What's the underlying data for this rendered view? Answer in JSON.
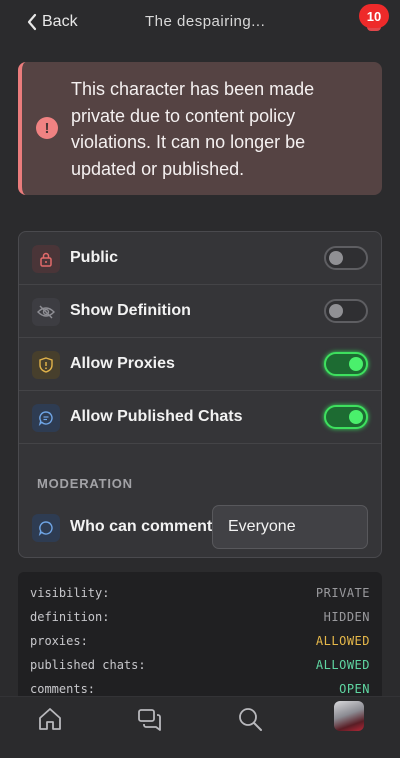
{
  "header": {
    "back_label": "Back",
    "title": "The despairing...",
    "notification_count": "10"
  },
  "alert": {
    "icon": "exclamation-icon",
    "message": "This character has been made private due to content policy violations. It can no longer be updated or published."
  },
  "settings": {
    "rows": [
      {
        "label": "Public",
        "icon": "lock-icon",
        "enabled": false
      },
      {
        "label": "Show Definition",
        "icon": "eye-off-icon",
        "enabled": false
      },
      {
        "label": "Allow Proxies",
        "icon": "shield-alert-icon",
        "enabled": true
      },
      {
        "label": "Allow Published Chats",
        "icon": "chat-bubble-icon",
        "enabled": true
      }
    ],
    "moderation_header": "MODERATION",
    "comment_label": "Who can comment",
    "comment_value": "Everyone"
  },
  "summary": [
    {
      "key": "visibility:",
      "value": "PRIVATE",
      "color": "#9a9a9e"
    },
    {
      "key": "definition:",
      "value": "HIDDEN",
      "color": "#9a9a9e"
    },
    {
      "key": "proxies:",
      "value": "ALLOWED",
      "color": "#e6b84a"
    },
    {
      "key": "published chats:",
      "value": "ALLOWED",
      "color": "#5fd6a2"
    },
    {
      "key": "comments:",
      "value": "OPEN",
      "color": "#5fd6a2"
    }
  ],
  "nav": {
    "items": [
      "home-icon",
      "chats-icon",
      "search-icon",
      "profile-avatar"
    ]
  },
  "colors": {
    "background": "#2b2b2d",
    "alert_bg": "#554343",
    "alert_accent": "#ea7c7c",
    "toggle_on": "#3ee05e",
    "badge": "#ee2a2a"
  }
}
